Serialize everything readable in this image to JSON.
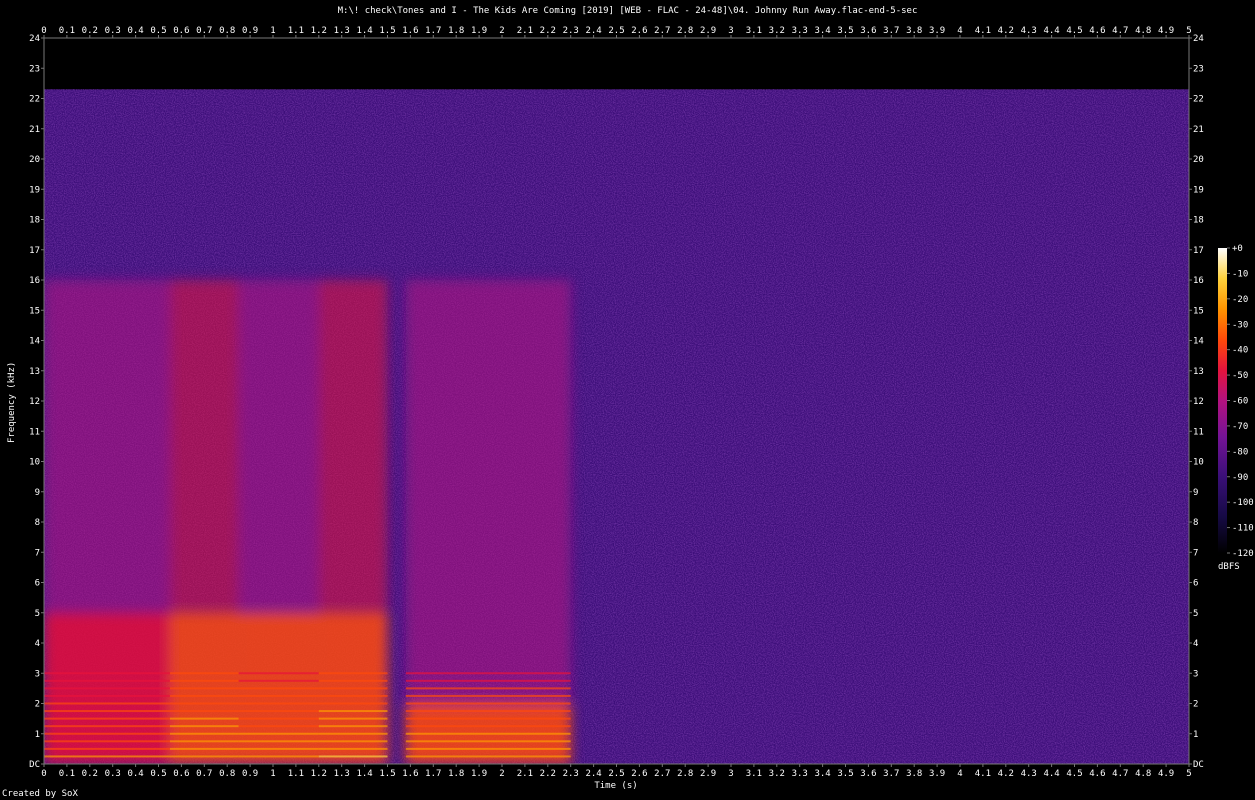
{
  "title": "M:\\! check\\Tones and I - The Kids Are Coming [2019] [WEB - FLAC - 24-48]\\04. Johnny Run Away.flac-end-5-sec",
  "credit": "Created by SoX",
  "colors": {
    "background": "#000000",
    "axis": "#777777",
    "text": "#ffffff",
    "palette": [
      "#000000",
      "#1a0b4d",
      "#3d0f7a",
      "#7a1296",
      "#b8117f",
      "#e8123a",
      "#ff4a0a",
      "#ff9a00",
      "#ffd23c",
      "#ffffff"
    ]
  },
  "chart_data": {
    "type": "heatmap",
    "xlabel": "Time (s)",
    "ylabel": "Frequency (kHz)",
    "xlim": [
      0,
      5
    ],
    "ylim": [
      0,
      24
    ],
    "x_ticks": [
      "0",
      "0.1",
      "0.2",
      "0.3",
      "0.4",
      "0.5",
      "0.6",
      "0.7",
      "0.8",
      "0.9",
      "1",
      "1.1",
      "1.2",
      "1.3",
      "1.4",
      "1.5",
      "1.6",
      "1.7",
      "1.8",
      "1.9",
      "2",
      "2.1",
      "2.2",
      "2.3",
      "2.4",
      "2.5",
      "2.6",
      "2.7",
      "2.8",
      "2.9",
      "3",
      "3.1",
      "3.2",
      "3.3",
      "3.4",
      "3.5",
      "3.6",
      "3.7",
      "3.8",
      "3.9",
      "4",
      "4.1",
      "4.2",
      "4.3",
      "4.4",
      "4.5",
      "4.6",
      "4.7",
      "4.8",
      "4.9",
      "5"
    ],
    "y_ticks": [
      "DC",
      "1",
      "2",
      "3",
      "4",
      "5",
      "6",
      "7",
      "8",
      "9",
      "10",
      "11",
      "12",
      "13",
      "14",
      "15",
      "16",
      "17",
      "18",
      "19",
      "20",
      "21",
      "22",
      "23",
      "24"
    ],
    "colorbar": {
      "unit": "dBFS",
      "range": [
        -120,
        0
      ],
      "ticks": [
        "+0",
        "-10",
        "-20",
        "-30",
        "-40",
        "-50",
        "-60",
        "-70",
        "-80",
        "-90",
        "-100",
        "-110",
        "-120"
      ]
    },
    "noise_floor_dbfs": -100,
    "cutoff_khz": 22.3,
    "events": [
      {
        "t_start": 0.0,
        "t_end": 0.55,
        "f_max_khz": 5,
        "level_dbfs": -50
      },
      {
        "t_start": 0.55,
        "t_end": 0.85,
        "f_max_khz": 5,
        "level_dbfs": -40
      },
      {
        "t_start": 0.85,
        "t_end": 1.2,
        "f_max_khz": 5,
        "level_dbfs": -45
      },
      {
        "t_start": 1.2,
        "t_end": 1.5,
        "f_max_khz": 5,
        "level_dbfs": -38
      },
      {
        "t_start": 1.58,
        "t_end": 2.3,
        "f_max_khz": 2,
        "level_dbfs": -45
      }
    ]
  }
}
